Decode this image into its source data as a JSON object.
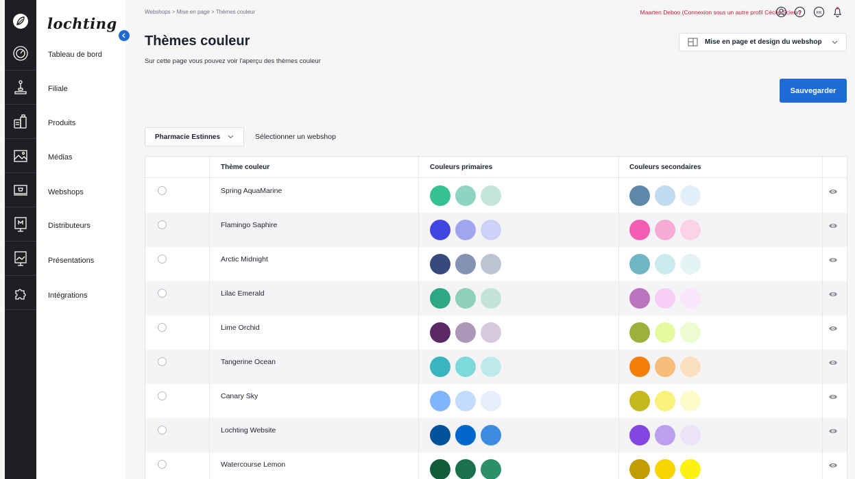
{
  "brand": {
    "name": "lochting"
  },
  "rail": {
    "icons": [
      "logo-leaf-icon",
      "dashboard-gauge-icon",
      "branch-joystick-icon",
      "products-boxes-icon",
      "media-image-icon",
      "webshop-cart-icon",
      "distributor-monitor-icon",
      "presentation-board-icon",
      "integration-puzzle-icon"
    ]
  },
  "sidebar": {
    "items": [
      {
        "label": "Tableau de bord"
      },
      {
        "label": "Filiale"
      },
      {
        "label": "Produits"
      },
      {
        "label": "Médias"
      },
      {
        "label": "Webshops"
      },
      {
        "label": "Distributeurs"
      },
      {
        "label": "Présentations"
      },
      {
        "label": "Intégrations"
      }
    ]
  },
  "header": {
    "breadcrumb": "Webshops > Mise en page > Thèmes couleur",
    "user": "Maarten Deboo (Connexion sous un autre profil Cécile Scieur)",
    "language": "FR",
    "title": "Thèmes couleur",
    "subtitle": "Sur cette page vous pouvez voir l'aperçu des thèmes couleur",
    "layout_select": "Mise en page et design du webshop",
    "save_label": "Sauvegarder"
  },
  "shop_filter": {
    "selected": "Pharmacie Estinnes",
    "hint": "Sélectionner un webshop"
  },
  "table": {
    "columns": [
      "Thème couleur",
      "Couleurs primaires",
      "Couleurs secondaires"
    ],
    "rows": [
      {
        "name": "Spring AquaMarine",
        "primary": [
          "#35c290",
          "#8fd4c0",
          "#c5e5dc"
        ],
        "secondary": [
          "#5e88a8",
          "#c1dcf1",
          "#e3eff8"
        ]
      },
      {
        "name": "Flamingo Saphire",
        "primary": [
          "#3f47e3",
          "#9fa5ef",
          "#cdd0f7"
        ],
        "secondary": [
          "#f45bb2",
          "#f7abd5",
          "#fbd2e8"
        ]
      },
      {
        "name": "Arctic Midnight",
        "primary": [
          "#374a7f",
          "#8593b2",
          "#bcc4d4"
        ],
        "secondary": [
          "#6fb7c5",
          "#cbeaed",
          "#e4f3f4"
        ]
      },
      {
        "name": "Lilac Emerald",
        "primary": [
          "#2ea883",
          "#8dd0bb",
          "#c3e2d8"
        ],
        "secondary": [
          "#bc73bd",
          "#f7cdf4",
          "#fae5fb"
        ]
      },
      {
        "name": "Lime Orchid",
        "primary": [
          "#5b2a66",
          "#ae97b6",
          "#d7c9dc"
        ],
        "secondary": [
          "#9cb03d",
          "#e4f9a0",
          "#eefbd0"
        ]
      },
      {
        "name": "Tangerine Ocean",
        "primary": [
          "#38b5bf",
          "#7ed9dc",
          "#bfeaeb"
        ],
        "secondary": [
          "#f57e06",
          "#f6bd7b",
          "#fbdfc0"
        ]
      },
      {
        "name": "Canary Sky",
        "primary": [
          "#7fb5fb",
          "#c3dbfa",
          "#e5effc"
        ],
        "secondary": [
          "#c4b91c",
          "#f7f37b",
          "#fbfac8"
        ]
      },
      {
        "name": "Lochting Website",
        "primary": [
          "#01529b",
          "#0168cb",
          "#3b8cdf"
        ],
        "secondary": [
          "#8446e0",
          "#bd9ff0",
          "#ece3f9"
        ]
      },
      {
        "name": "Watercourse Lemon",
        "primary": [
          "#115c3b",
          "#1b7050",
          "#2b8f6a"
        ],
        "secondary": [
          "#c29d01",
          "#f7d600",
          "#fcf014"
        ]
      }
    ]
  }
}
